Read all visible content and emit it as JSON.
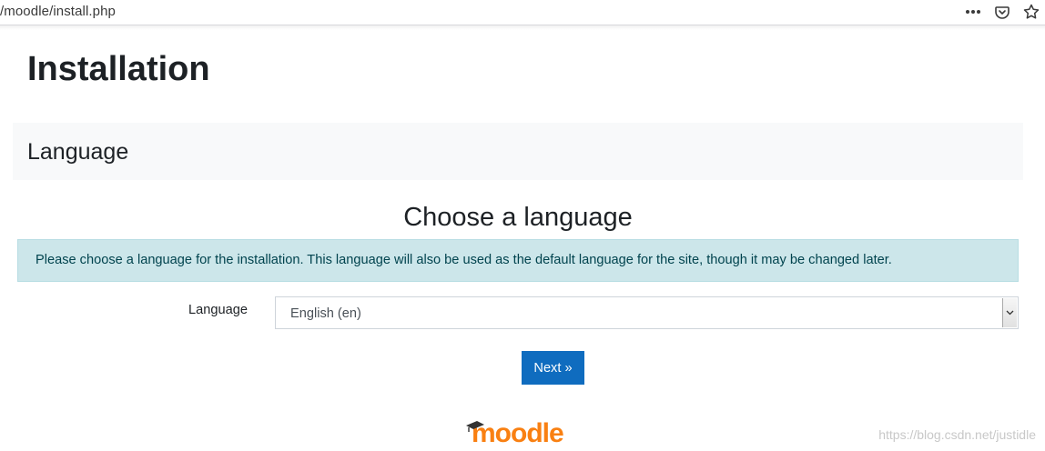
{
  "browser": {
    "url": "/moodle/install.php",
    "actions": [
      {
        "name": "more-actions-icon",
        "glyph": "•••"
      },
      {
        "name": "pocket-icon"
      },
      {
        "name": "bookmark-star-icon",
        "glyph": "☆"
      }
    ]
  },
  "page": {
    "title": "Installation"
  },
  "section": {
    "header": "Language"
  },
  "main": {
    "heading": "Choose a language",
    "info_message": "Please choose a language for the installation. This language will also be used as the default language for the site, though it may be changed later.",
    "language_field": {
      "label": "Language",
      "selected": "English (en)"
    },
    "next_label": "Next »"
  },
  "footer": {
    "logo_text": "moodle",
    "watermark": "https://blog.csdn.net/justidle"
  },
  "colors": {
    "primary": "#0f6cbf",
    "info_bg": "#cce6ea",
    "info_text": "#00434e",
    "section_bg": "#f8f9fa",
    "moodle_orange": "#f98012"
  }
}
